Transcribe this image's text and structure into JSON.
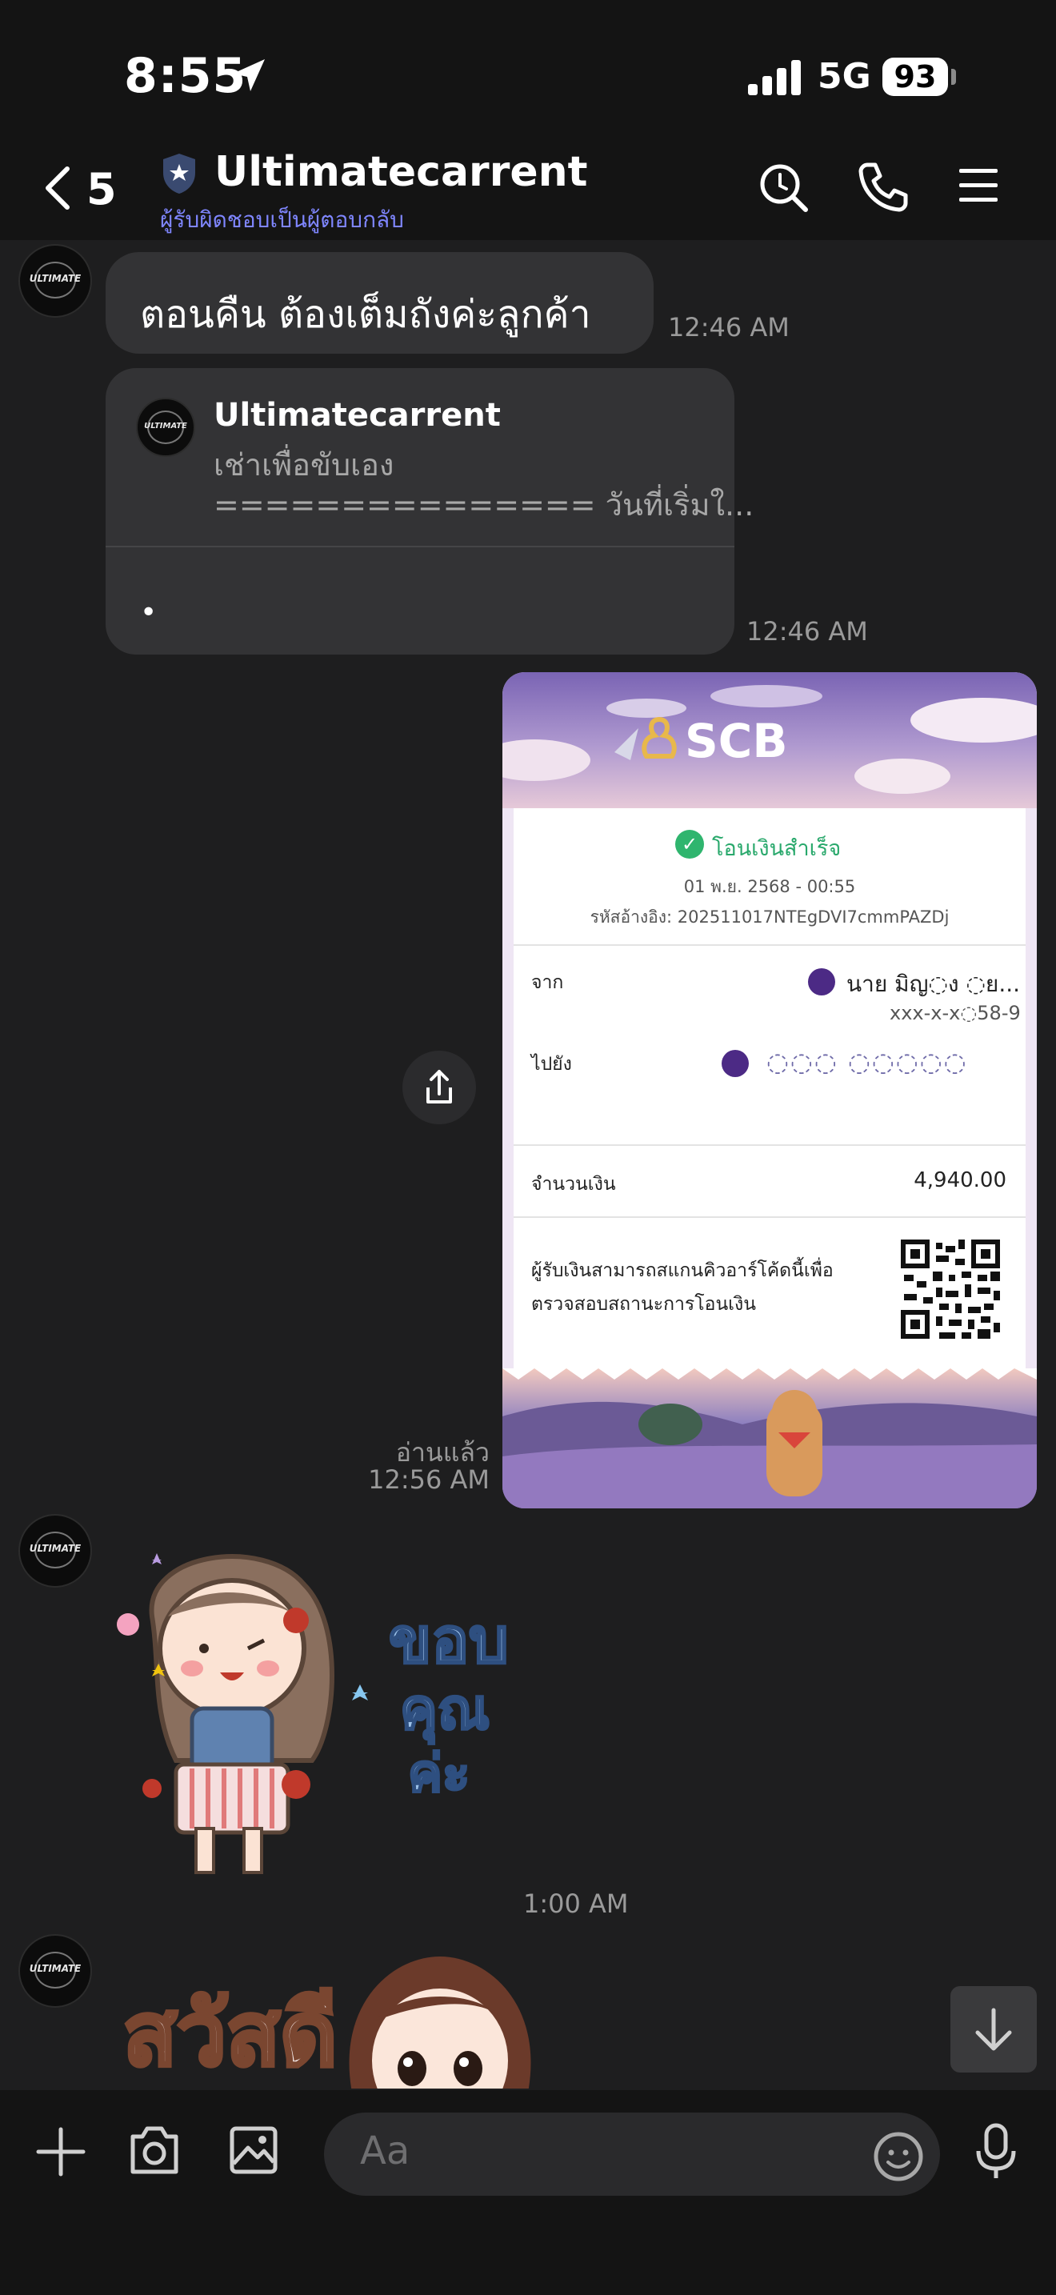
{
  "status_bar": {
    "time": "8:55",
    "network": "5G",
    "battery": "93"
  },
  "header": {
    "unread_count": "5",
    "title": "Ultimatecarrent",
    "subtitle": "ผู้รับผิดชอบเป็นผู้ตอบกลับ"
  },
  "messages": {
    "msg1": {
      "text": "ตอนคืน ต้องเต็มถังค่ะลูกค้า",
      "time": "12:46 AM"
    },
    "msg2": {
      "quote_name": "Ultimatecarrent",
      "quote_line1": "เช่าเพื่อขับเอง",
      "quote_line2": "=============== วันที่เริ่มใ...",
      "body": "•",
      "time": "12:46 AM"
    },
    "receipt": {
      "logo": "SCB",
      "status": "โอนเงินสำเร็จ",
      "date": "01 พ.ย. 2568 - 00:55",
      "ref": "รหัสอ้างอิง: 202511017NTEgDVI7cmmPAZDj",
      "from_label": "จาก",
      "from_name": "นาย มิญ◌ง ◌ย...",
      "from_account": "xxx-x-x◌58-9",
      "to_label": "ไปยัง",
      "to_name": "◌◌◌ ◌◌◌◌◌",
      "amount_label": "จำนวนเงิน",
      "amount": "4,940.00",
      "note_line1": "ผู้รับเงินสามารถสแกนคิวอาร์โค้ดนี้เพื่อ",
      "note_line2": "ตรวจสอบสถานะการโอนเงิน",
      "read": "อ่านแล้ว",
      "time": "12:56 AM"
    },
    "sticker1": {
      "text": "ขอบ คุณ ค่ะ",
      "line1": "ขอบ",
      "line2": "คุณ",
      "line3": "ค่ะ",
      "time": "1:00 AM"
    },
    "sticker2": {
      "text": "สวัสดี"
    }
  },
  "composer": {
    "placeholder": "Aa"
  },
  "colors": {
    "background": "#1e1e1f",
    "bubble": "#333335",
    "subtitle": "#7f86ff",
    "success": "#28a86b"
  }
}
